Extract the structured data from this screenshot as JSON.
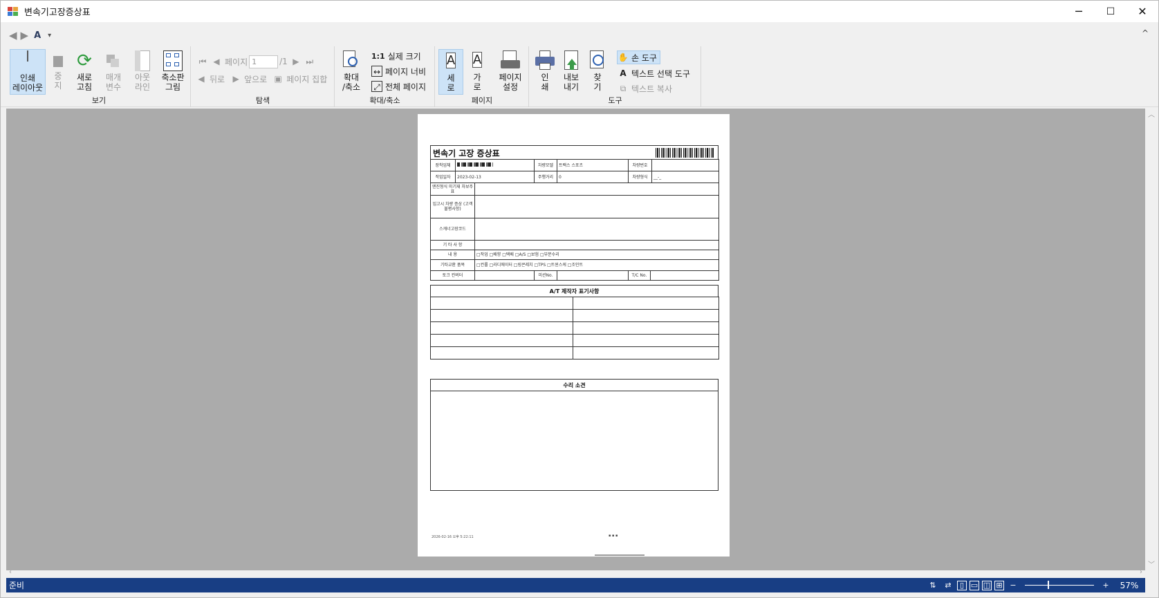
{
  "window": {
    "title": "변속기고장증상표",
    "minimize": "─",
    "maximize": "☐",
    "close": "✕"
  },
  "quick_access": {
    "back_icon": "arrow-left-circle-icon",
    "forward_icon": "arrow-right-circle-icon",
    "text_icon_label": "A",
    "dropdown": "▾",
    "collapse": "^"
  },
  "ribbon": {
    "groups": {
      "view": "보기",
      "navigate": "탐색",
      "zoom": "확대/축소",
      "page": "페이지",
      "tools": "도구"
    },
    "view": {
      "print_layout": [
        "인쇄",
        "레이아웃"
      ],
      "stop": [
        "중",
        "지"
      ],
      "refresh": [
        "새로",
        "고침"
      ],
      "parameters": [
        "매개",
        "변수"
      ],
      "outline": [
        "아웃",
        "라인"
      ],
      "thumbnails": [
        "축소판",
        "그림"
      ]
    },
    "navigate": {
      "page_label": "페이지",
      "page_value": "1",
      "page_total": "/1",
      "back": "뒤로",
      "forward": "앞으로",
      "page_set": "페이지 집합"
    },
    "zoom": {
      "zoom_inout": [
        "확대",
        "/축소"
      ],
      "actual_size_prefix": "1:1",
      "actual_size": "실제 크기",
      "page_width": "페이지 너비",
      "whole_page": "전체 페이지"
    },
    "page": {
      "portrait": [
        "세",
        "로"
      ],
      "landscape": [
        "가",
        "로"
      ],
      "page_setup": [
        "페이지",
        "설정"
      ],
      "portrait_letter": "A",
      "landscape_letter": "A"
    },
    "tools": {
      "print": [
        "인",
        "쇄"
      ],
      "export": [
        "내보",
        "내기"
      ],
      "find": [
        "찾",
        "기"
      ],
      "hand_tool": "손 도구",
      "text_select": "텍스트 선택 도구",
      "text_copy": "텍스트 복사"
    }
  },
  "report": {
    "title": "변속기 고장 증상표",
    "row1": [
      "장착업체",
      "",
      "차량모델",
      "트랙스 스포츠",
      "차량번호",
      ""
    ],
    "row2": [
      "작업일자",
      "2023-02-13",
      "주행거리",
      "0",
      "차량형식",
      "__-_"
    ],
    "rows": [
      {
        "label": "엔진형식 미기재 차보주표",
        "value": ""
      },
      {
        "label": "입고시 차량 증상 (고객불평사항)",
        "value": ""
      },
      {
        "label": "스캐너고장코드",
        "value": ""
      },
      {
        "label": "기 타 사 항",
        "value": ""
      },
      {
        "label": "내 용",
        "value": "□작업 □배향 □택배 □A/S □보험 □부분수리"
      },
      {
        "label": "기타교환 품목",
        "value": "□컨롤 □라디에이터 □링콘레치 □TPS □트윈스케 □조인트"
      }
    ],
    "last_row": [
      "토크 컨버터",
      "",
      "미션No.",
      "",
      "T/C No.",
      ""
    ],
    "at_section": "A/T 제작자 표기사항",
    "repair_section": "수리 소견",
    "footer_date": "2026-02-16 오후 5:22:11",
    "footer_mark": "▪ ▪ ▪"
  },
  "status": {
    "text": "준비",
    "zoom": "57%",
    "zoom_fraction": 0.33
  }
}
